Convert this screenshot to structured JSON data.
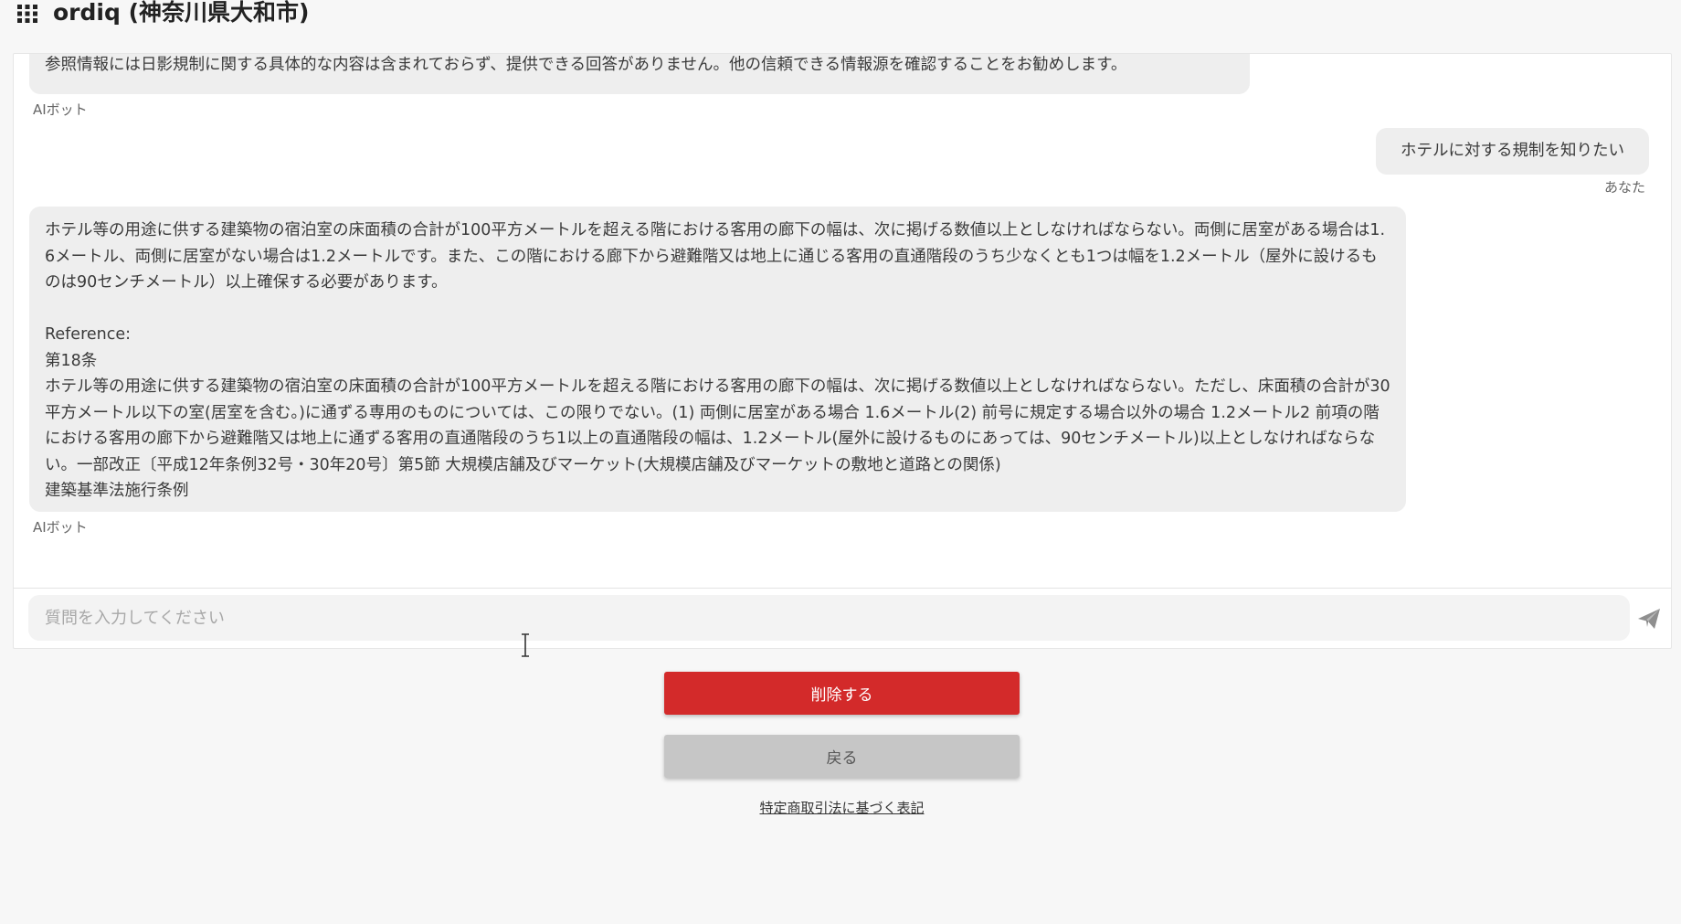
{
  "header": {
    "title": "ordiq (神奈川県大和市)",
    "menu_icon": "grid-icon"
  },
  "chat": {
    "messages": [
      {
        "role": "bot",
        "text": "参照情報には日影規制に関する具体的な内容は含まれておらず、提供できる回答がありません。他の信頼できる情報源を確認することをお勧めします。",
        "sender": "AIボット"
      },
      {
        "role": "user",
        "text": "ホテルに対する規制を知りたい",
        "sender": "あなた"
      },
      {
        "role": "bot",
        "answer": "ホテル等の用途に供する建築物の宿泊室の床面積の合計が100平方メートルを超える階における客用の廊下の幅は、次に掲げる数値以上としなければならない。両側に居室がある場合は1.6メートル、両側に居室がない場合は1.2メートルです。また、この階における廊下から避難階又は地上に通じる客用の直通階段のうち少なくとも1つは幅を1.2メートル（屋外に設けるものは90センチメートル）以上確保する必要があります。",
        "reference_label": "Reference:",
        "article": "第18条",
        "reference_text": "ホテル等の用途に供する建築物の宿泊室の床面積の合計が100平方メートルを超える階における客用の廊下の幅は、次に掲げる数値以上としなければならない。ただし、床面積の合計が30平方メートル以下の室(居室を含む。)に通ずる専用のものについては、この限りでない。(1) 両側に居室がある場合 1.6メートル(2) 前号に規定する場合以外の場合 1.2メートル2 前項の階における客用の廊下から避難階又は地上に通ずる客用の直通階段のうち1以上の直通階段の幅は、1.2メートル(屋外に設けるものにあっては、90センチメートル)以上としなければならない。一部改正〔平成12年条例32号・30年20号〕第5節 大規模店舗及びマーケット(大規模店舗及びマーケットの敷地と道路との関係)",
        "source": "建築基準法施行条例",
        "sender": "AIボット"
      }
    ]
  },
  "input": {
    "placeholder": "質問を入力してください",
    "value": "",
    "send_icon": "paper-plane-icon"
  },
  "actions": {
    "delete_label": "削除する",
    "back_label": "戻る",
    "legal_link": "特定商取引法に基づく表記"
  },
  "colors": {
    "background": "#f7f7f7",
    "bubble": "#eeeeee",
    "delete": "#d32a2a",
    "back": "#c6c6c6"
  }
}
